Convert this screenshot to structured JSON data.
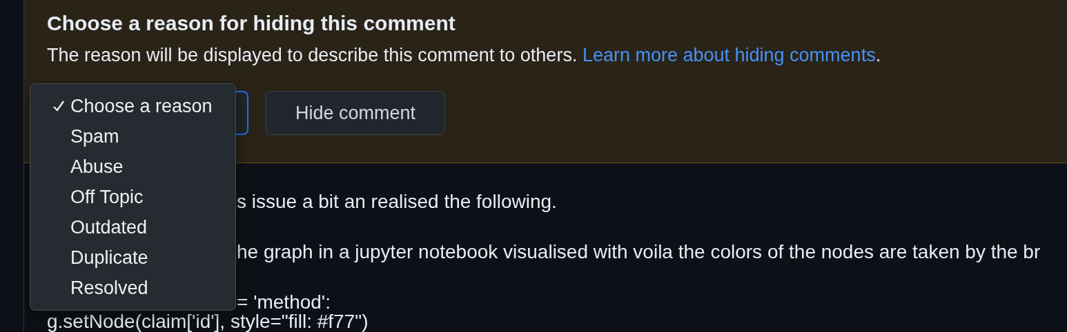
{
  "hide_panel": {
    "title": "Choose a reason for hiding this comment",
    "description": "The reason will be displayed to describe this comment to others. ",
    "link": "Learn more about hiding comments",
    "after_link": ".",
    "reason_menu": [
      {
        "label": "Choose a reason",
        "selected": true
      },
      {
        "label": "Spam",
        "selected": false
      },
      {
        "label": "Abuse",
        "selected": false
      },
      {
        "label": "Off Topic",
        "selected": false
      },
      {
        "label": "Outdated",
        "selected": false
      },
      {
        "label": "Duplicate",
        "selected": false
      },
      {
        "label": "Resolved",
        "selected": false
      }
    ],
    "hide_button": "Hide comment"
  },
  "comment_body": {
    "partly_covered_lines": [
      "s issue a bit an realised the following.",
      "he graph in a jupyter notebook visualised with voila the colors of the nodes are taken by the br",
      "= 'method':"
    ],
    "code_line": "g.setNode(claim['id'], style=\"fill: #f77\")"
  }
}
